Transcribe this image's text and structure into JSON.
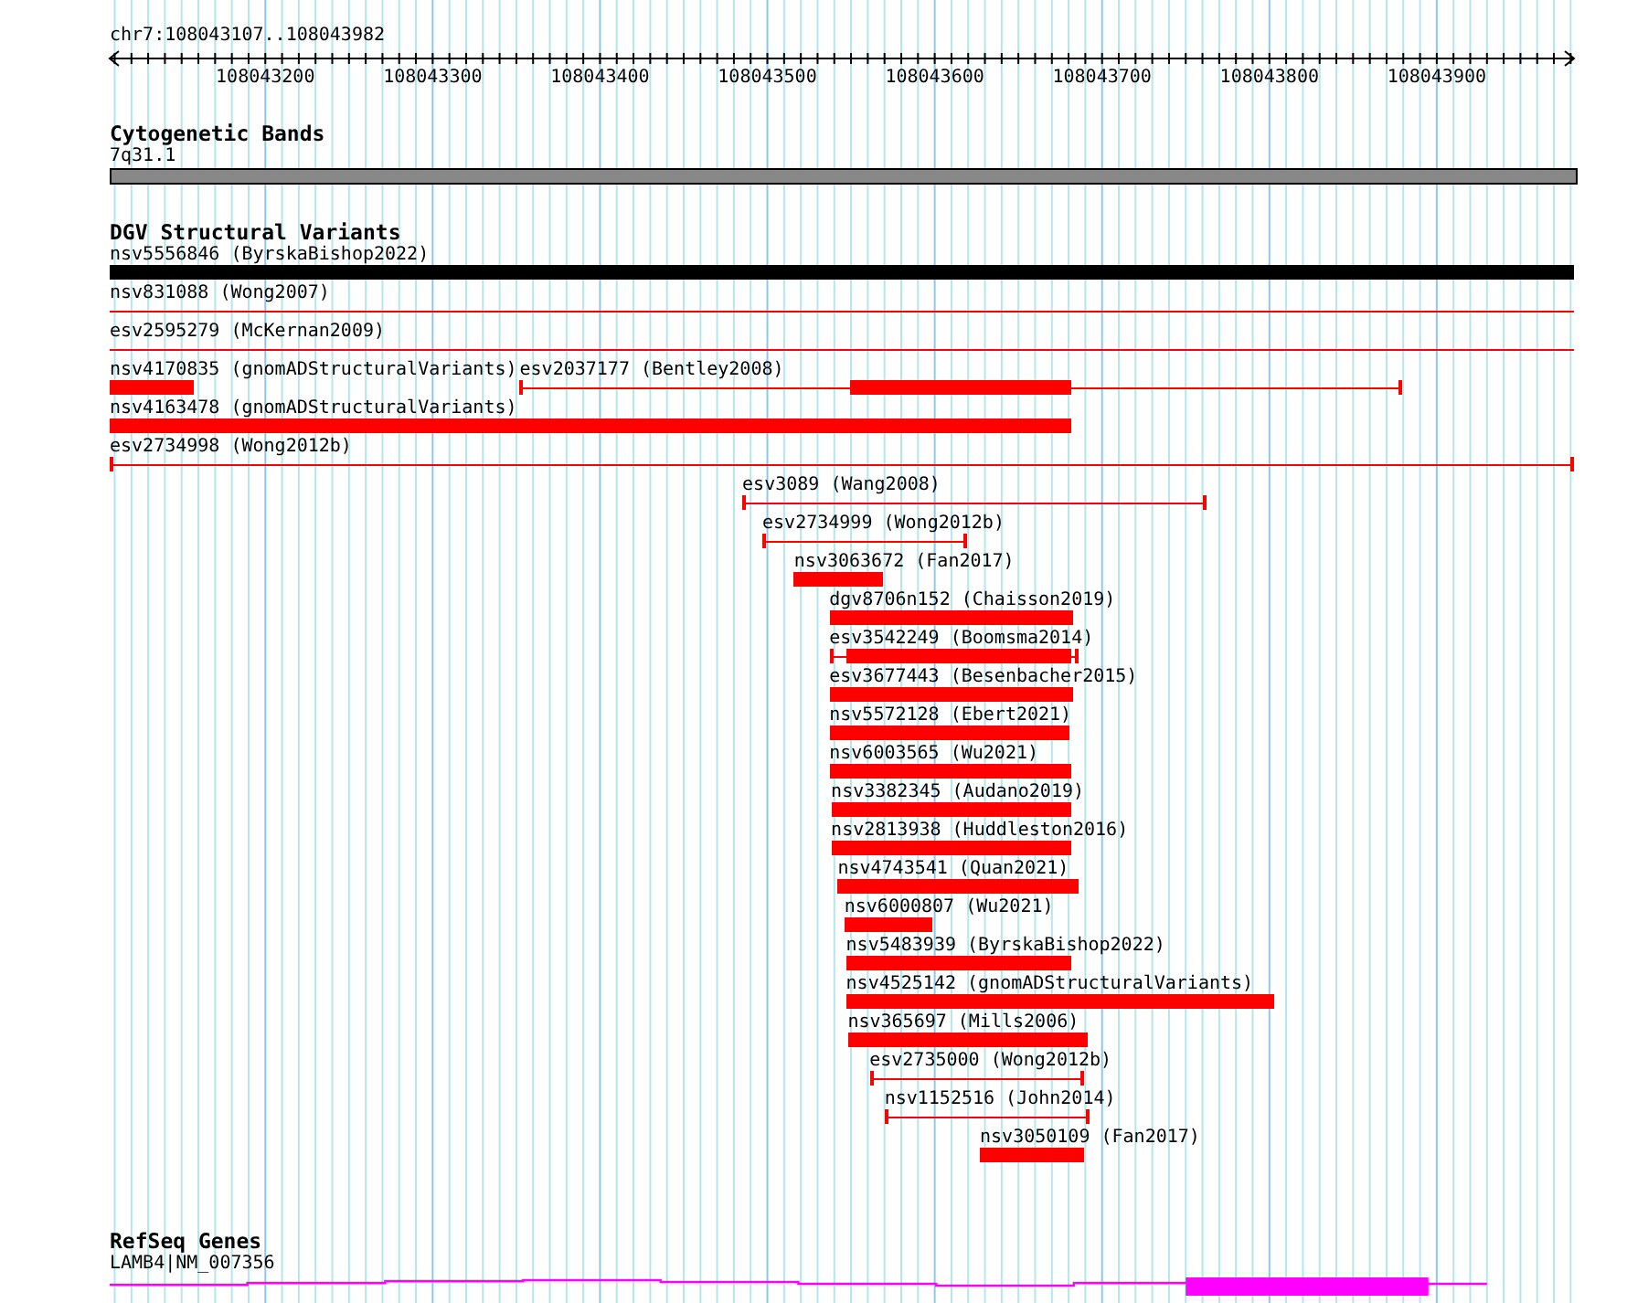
{
  "ruler": {
    "location": "chr7:108043107..108043982",
    "ticks": [
      {
        "label": "108043200"
      },
      {
        "label": "108043300"
      },
      {
        "label": "108043400"
      },
      {
        "label": "108043500"
      },
      {
        "label": "108043600"
      },
      {
        "label": "108043700"
      },
      {
        "label": "108043800"
      },
      {
        "label": "108043900"
      }
    ]
  },
  "tracks": [
    {
      "title": "Cytogenetic Bands",
      "kind": "bands",
      "features": [
        {
          "label": "7q31.1",
          "color": "#888888"
        }
      ]
    },
    {
      "title": "DGV Structural Variants",
      "kind": "variants",
      "rows": [
        [
          {
            "label": "nsv5556846 (ByrskaBishop2022)",
            "kind": "bar",
            "color": "#000000"
          }
        ],
        [
          {
            "label": "nsv831088 (Wong2007)",
            "kind": "line",
            "color": "#ff0000"
          }
        ],
        [
          {
            "label": "esv2595279 (McKernan2009)",
            "kind": "line",
            "color": "#ff0000"
          }
        ],
        [
          {
            "label": "nsv4170835 (gnomADStructuralVariants)",
            "kind": "bar",
            "color": "#ff0000"
          },
          {
            "label": "esv2037177 (Bentley2008)",
            "kind": "whisker",
            "color": "#ff0000"
          }
        ],
        [
          {
            "label": "nsv4163478 (gnomADStructuralVariants)",
            "kind": "bar",
            "color": "#ff0000"
          }
        ],
        [
          {
            "label": "esv2734998 (Wong2012b)",
            "kind": "whisker",
            "color": "#ff0000"
          }
        ],
        [
          {
            "label": "esv3089 (Wang2008)",
            "kind": "whisker",
            "color": "#ff0000"
          }
        ],
        [
          {
            "label": "esv2734999 (Wong2012b)",
            "kind": "whisker",
            "color": "#ff0000"
          }
        ],
        [
          {
            "label": "nsv3063672 (Fan2017)",
            "kind": "bar",
            "color": "#ff0000"
          }
        ],
        [
          {
            "label": "dgv8706n152 (Chaisson2019)",
            "kind": "bar",
            "color": "#ff0000"
          }
        ],
        [
          {
            "label": "esv3542249 (Boomsma2014)",
            "kind": "whisker",
            "color": "#ff0000"
          }
        ],
        [
          {
            "label": "esv3677443 (Besenbacher2015)",
            "kind": "bar",
            "color": "#ff0000"
          }
        ],
        [
          {
            "label": "nsv5572128 (Ebert2021)",
            "kind": "bar",
            "color": "#ff0000"
          }
        ],
        [
          {
            "label": "nsv6003565 (Wu2021)",
            "kind": "bar",
            "color": "#ff0000"
          }
        ],
        [
          {
            "label": "nsv3382345 (Audano2019)",
            "kind": "bar",
            "color": "#ff0000"
          }
        ],
        [
          {
            "label": "nsv2813938 (Huddleston2016)",
            "kind": "bar",
            "color": "#ff0000"
          }
        ],
        [
          {
            "label": "nsv4743541 (Quan2021)",
            "kind": "bar",
            "color": "#ff0000"
          }
        ],
        [
          {
            "label": "nsv6000807 (Wu2021)",
            "kind": "bar",
            "color": "#ff0000"
          }
        ],
        [
          {
            "label": "nsv5483939 (ByrskaBishop2022)",
            "kind": "bar",
            "color": "#ff0000"
          }
        ],
        [
          {
            "label": "nsv4525142 (gnomADStructuralVariants)",
            "kind": "bar",
            "color": "#ff0000"
          }
        ],
        [
          {
            "label": "nsv365697 (Mills2006)",
            "kind": "bar",
            "color": "#ff0000"
          }
        ],
        [
          {
            "label": "esv2735000 (Wong2012b)",
            "kind": "whisker",
            "color": "#ff0000"
          }
        ],
        [
          {
            "label": "nsv1152516 (John2014)",
            "kind": "whisker",
            "color": "#ff0000"
          }
        ],
        [
          {
            "label": "nsv3050109 (Fan2017)",
            "kind": "bar",
            "color": "#ff0000"
          }
        ]
      ]
    },
    {
      "title": "RefSeq Genes",
      "kind": "genes",
      "features": [
        {
          "label": "LAMB4|NM_007356",
          "color": "#ff00ff"
        }
      ]
    }
  ]
}
